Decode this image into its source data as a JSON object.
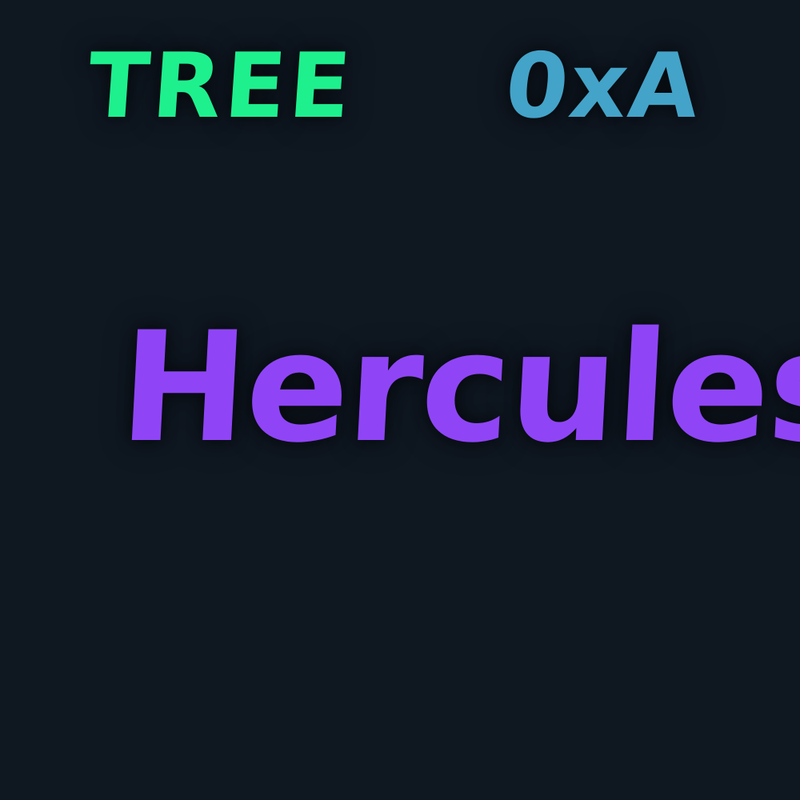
{
  "labels": {
    "top_left": "TREE",
    "top_right": "0xA",
    "center": "Hercules"
  },
  "colors": {
    "background": "#0f1721",
    "top_left": "#1ef08e",
    "top_right": "#44a3c8",
    "center": "#8f45f6"
  }
}
